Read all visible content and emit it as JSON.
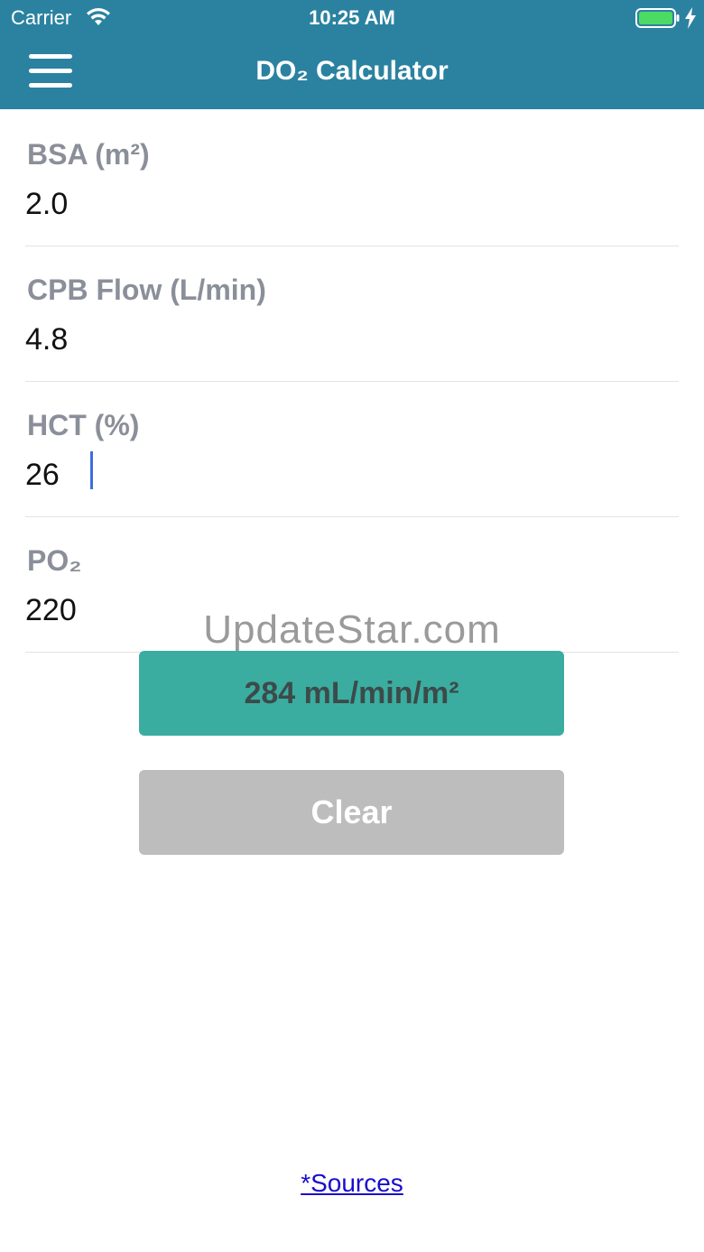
{
  "status_bar": {
    "carrier": "Carrier",
    "time": "10:25 AM",
    "battery_color": "#4cd964"
  },
  "nav": {
    "title": "DO₂ Calculator",
    "menu_icon": "hamburger-menu-icon",
    "background_color": "#2b82a0"
  },
  "fields": [
    {
      "label": "BSA (m²)",
      "value": "2.0"
    },
    {
      "label": "CPB Flow (L/min)",
      "value": "4.8"
    },
    {
      "label": "HCT (%)",
      "value": "26"
    },
    {
      "label": "PO₂",
      "value": "220"
    }
  ],
  "watermark": "UpdateStar.com",
  "result_button": {
    "label": "284 mL/min/m²",
    "color": "#3aada0"
  },
  "clear_button": {
    "label": "Clear",
    "color": "#bdbdbd"
  },
  "sources_link": "*Sources"
}
